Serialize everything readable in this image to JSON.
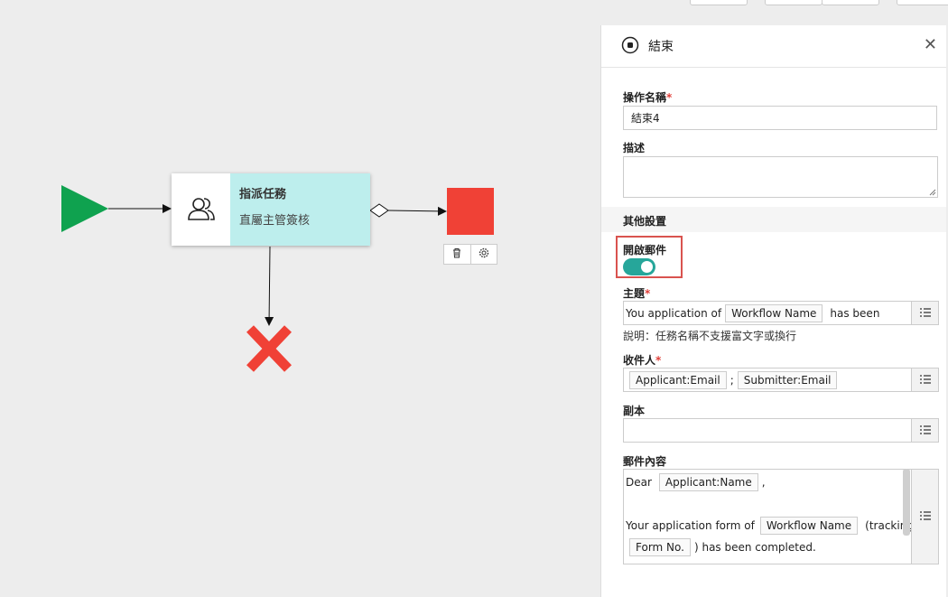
{
  "canvas": {
    "task_node": {
      "title": "指派任務",
      "subtitle": "直屬主管簽核",
      "icon": "users-icon"
    },
    "start_color": "#0fa24f",
    "end_color": "#f04136",
    "reject_color": "#f04136",
    "task_color": "#bdeeed"
  },
  "panel": {
    "title": "結束",
    "name_label": "操作名稱",
    "name_value": "結束4",
    "desc_label": "描述",
    "section_other": "其他設置",
    "enable_mail_label": "開啟郵件",
    "enable_mail_on": true,
    "subject_label": "主題",
    "subject": {
      "prefix": "You application of",
      "tag": "Workflow Name",
      "suffix": "has been"
    },
    "hint": "說明：任務名稱不支援富文字或換行",
    "recipients_label": "收件人",
    "recipients": [
      "Applicant:Email",
      "Submitter:Email"
    ],
    "recipients_sep": ";",
    "cc_label": "副本",
    "body_label": "郵件內容",
    "body": {
      "dear": "Dear",
      "tag_name": "Applicant:Name",
      "comma": ",",
      "line2_prefix": "Your application form of",
      "tag_workflow": "Workflow Name",
      "line2_suffix": "(tracking no.",
      "tag_form": "Form No.",
      "line3_suffix": ") has been completed."
    },
    "required_mark": "*",
    "close_icon": "✕"
  }
}
